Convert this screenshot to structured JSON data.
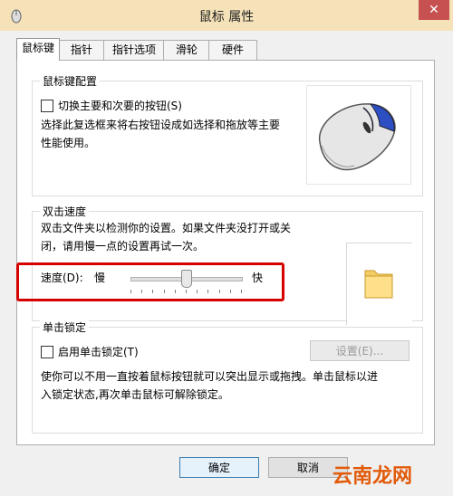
{
  "window": {
    "title": "鼠标 属性",
    "close_label": "✕"
  },
  "tabs": [
    "鼠标键",
    "指针",
    "指针选项",
    "滑轮",
    "硬件"
  ],
  "button_config": {
    "title": "鼠标键配置",
    "switch_label": "切换主要和次要的按钮(S)",
    "description_line1": "选择此复选框来将右按钮设成如选择和拖放等主要",
    "description_line2": "性能使用。"
  },
  "double_click": {
    "title": "双击速度",
    "description_line1": "双击文件夹以检测你的设置。如果文件夹没打开或关",
    "description_line2": "闭，请用慢一点的设置再试一次。",
    "speed_label": "速度(D):",
    "slow_label": "慢",
    "fast_label": "快",
    "speed_value": 0.5
  },
  "click_lock": {
    "title": "单击锁定",
    "enable_label": "启用单击锁定(T)",
    "settings_button": "设置(E)...",
    "description_line1": "使你可以不用一直按着鼠标按钮就可以突出显示或拖拽。单击鼠标以进",
    "description_line2": "入锁定状态,再次单击鼠标可解除锁定。"
  },
  "footer": {
    "ok": "确定",
    "cancel": "取消"
  },
  "watermark": "云南龙网"
}
